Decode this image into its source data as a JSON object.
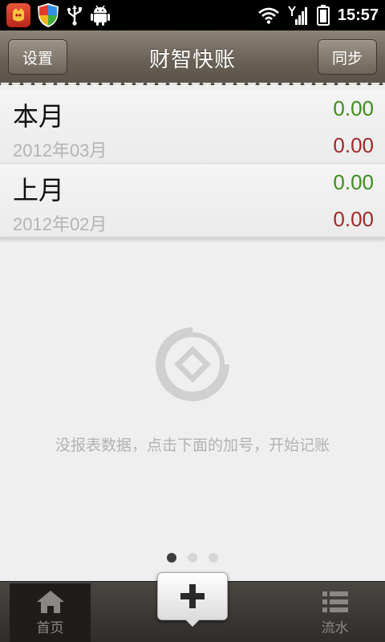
{
  "status_bar": {
    "time": "15:57",
    "icons": [
      "app-notification-icon",
      "security-shield-icon",
      "usb-icon",
      "android-debug-icon",
      "wifi-icon",
      "signal-icon",
      "battery-icon"
    ]
  },
  "header": {
    "title": "财智快账",
    "left_button": "设置",
    "right_button": "同步"
  },
  "summary": {
    "rows": [
      {
        "title": "本月",
        "date": "2012年03月",
        "income": "0.00",
        "expense": "0.00"
      },
      {
        "title": "上月",
        "date": "2012年02月",
        "income": "0.00",
        "expense": "0.00"
      }
    ]
  },
  "empty_state": {
    "message": "没报表数据，点击下面的加号，开始记账"
  },
  "pager": {
    "count": 3,
    "active_index": 0
  },
  "bottom_nav": {
    "home_label": "首页",
    "add_label": "+",
    "flow_label": "流水"
  },
  "colors": {
    "income": "#3e8e1e",
    "expense": "#9e2a2a",
    "title_bar": "#6a6257"
  }
}
